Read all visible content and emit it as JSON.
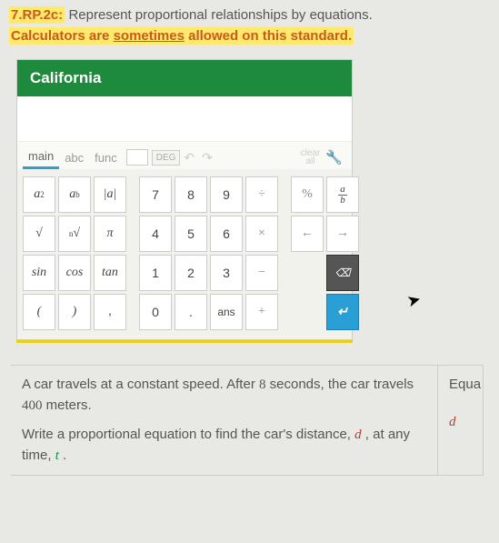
{
  "header": {
    "standard_code": "7.RP.2c:",
    "standard_text": "Represent proportional relationships by equations.",
    "calc_note_prefix": "Calculators are ",
    "calc_note_underlined": "sometimes",
    "calc_note_suffix": " allowed on this standard."
  },
  "calculator": {
    "title": "California",
    "tabs": {
      "main": "main",
      "abc": "abc",
      "func": "func"
    },
    "mode": "DEG",
    "clear": "clear",
    "all": "all",
    "keys": {
      "a2_base": "a",
      "a2_sup": "2",
      "ab_base": "a",
      "ab_sup": "b",
      "abs": "|a|",
      "k7": "7",
      "k8": "8",
      "k9": "9",
      "div": "÷",
      "pct": "%",
      "frac_top": "a",
      "frac_bot": "b",
      "sqrt": "√",
      "nroot_n": "n",
      "nroot": "√",
      "pi": "π",
      "k4": "4",
      "k5": "5",
      "k6": "6",
      "mul": "×",
      "left": "←",
      "right": "→",
      "sin": "sin",
      "cos": "cos",
      "tan": "tan",
      "k1": "1",
      "k2": "2",
      "k3": "3",
      "sub": "−",
      "back": "⌫",
      "lp": "(",
      "rp": ")",
      "comma": ",",
      "k0": "0",
      "dot": ".",
      "ans": "ans",
      "add": "+",
      "enter": "↵"
    }
  },
  "problem": {
    "p1a": "A car travels at a constant speed. After ",
    "p1_num1": "8",
    "p1b": " seconds, the car travels ",
    "p1_num2": "400",
    "p1c": " meters.",
    "p2a": "Write a proportional equation to find the car's distance, ",
    "p2_var1": "d",
    "p2b": " , at any time, ",
    "p2_var2": "t",
    "p2c": " .",
    "side1": "Equa",
    "side2": "d"
  }
}
